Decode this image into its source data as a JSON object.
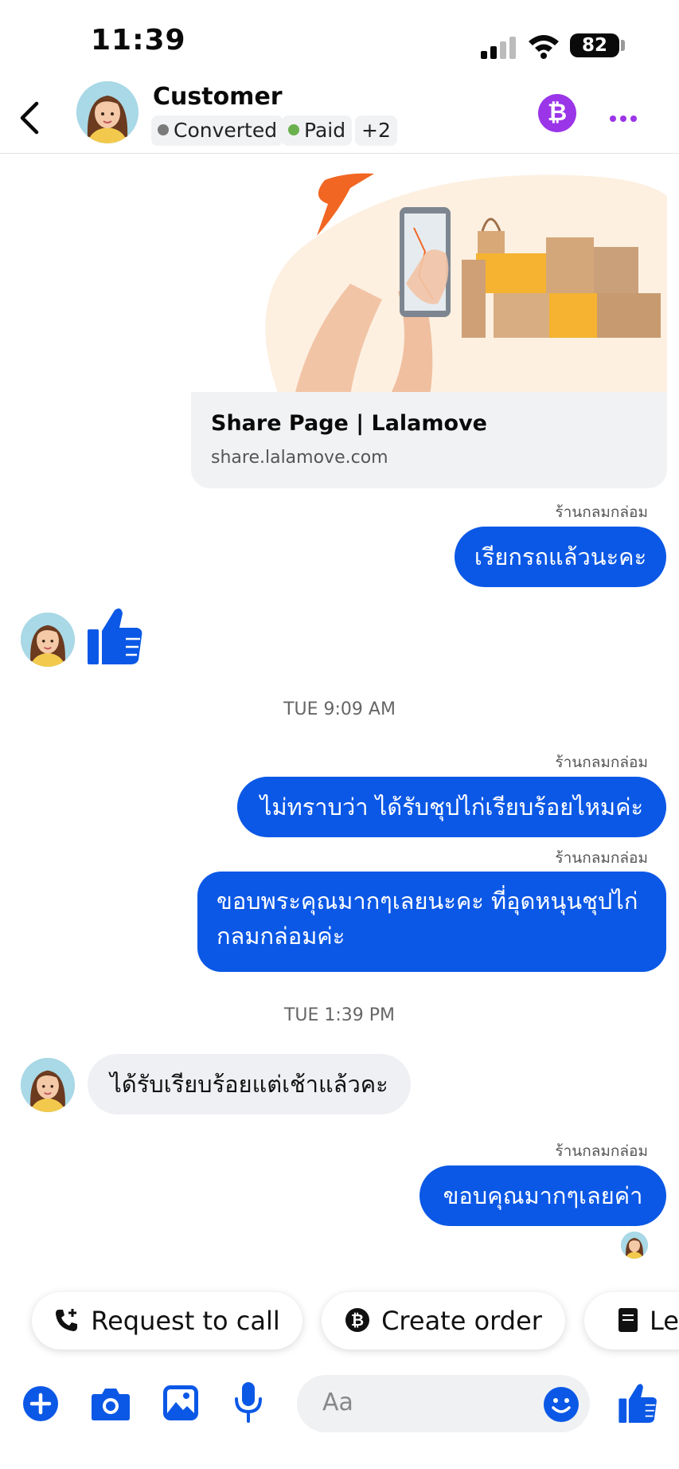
{
  "status_bar": {
    "time": "11:39",
    "battery": "82"
  },
  "header": {
    "title": "Customer",
    "tags": [
      {
        "label": "Converted",
        "color": "#7a7a7a"
      },
      {
        "label": "Paid",
        "color": "#6ab04c"
      },
      {
        "label": "+2"
      }
    ],
    "bitcoin_glyph": "₿",
    "accent": "#9b35e8"
  },
  "link_card": {
    "title": "Share Page | Lalamove",
    "url": "share.lalamove.com"
  },
  "messages": {
    "sender_1": "ร้านกลมกล่อม",
    "msg_1": "เรียกรถแล้วนะคะ",
    "time_1": "TUE 9:09 AM",
    "sender_2": "ร้านกลมกล่อม",
    "msg_2": "ไม่ทราบว่า ได้รับชุปไก่เรียบร้อยไหมค่ะ",
    "sender_3": "ร้านกลมกล่อม",
    "msg_3_line1": "ขอบพระคุณมากๆเลยนะคะ ที่อุดหนุนชุปไก่",
    "msg_3_line2": "กลมกล่อมค่ะ",
    "time_2": "TUE 1:39 PM",
    "incoming_2": "ได้รับเรียบร้อยแต่เช้าแล้วคะ",
    "sender_4": "ร้านกลมกล่อม",
    "msg_4": "ขอบคุณมากๆเลยค่า"
  },
  "quick_replies": {
    "request_call": "Request to call",
    "create_order": "Create order",
    "third": "Le"
  },
  "composer": {
    "placeholder": "Aa"
  },
  "colors": {
    "brand_blue": "#0b58e6",
    "bubble_in": "#eff0f3"
  }
}
